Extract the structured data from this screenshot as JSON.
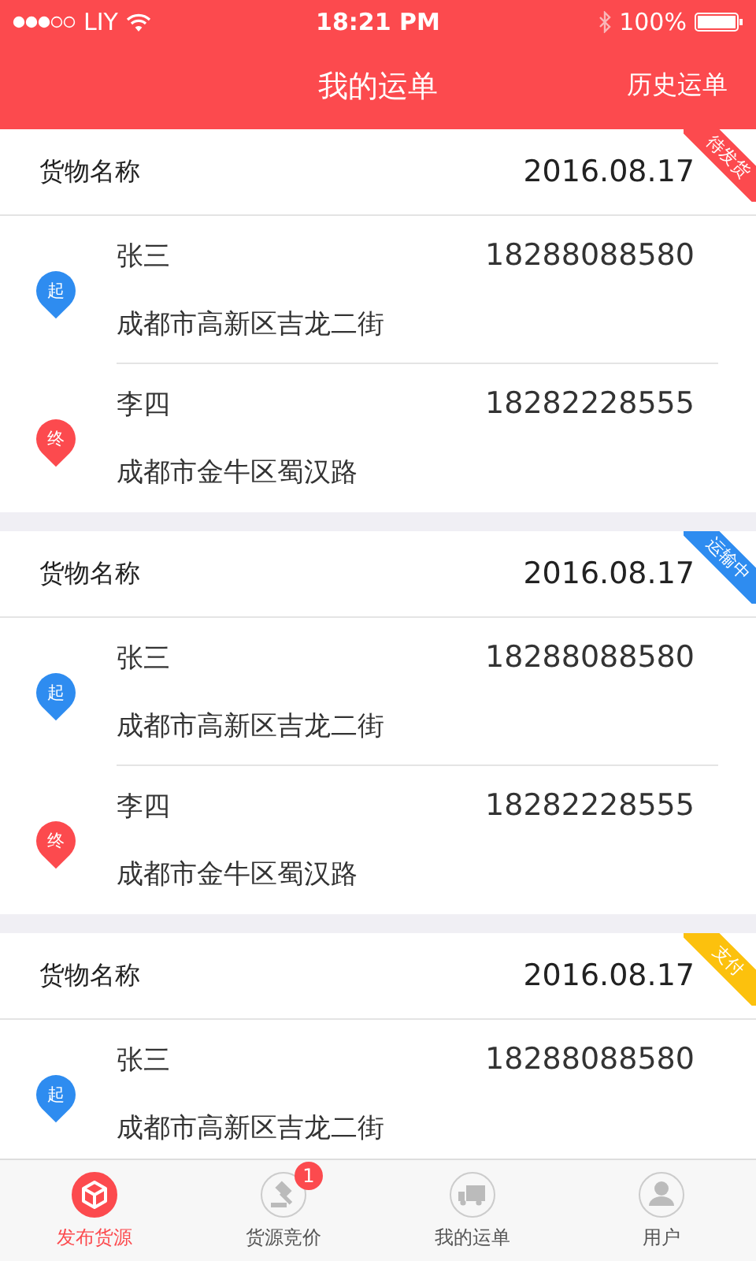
{
  "status_bar": {
    "carrier": "LIY",
    "time": "18:21 PM",
    "battery": "100%"
  },
  "nav": {
    "title": "我的运单",
    "action": "历史运单"
  },
  "orders": [
    {
      "cargo": "货物名称",
      "date": "2016.08.17",
      "status": "待发货",
      "color": "#fc4a4e",
      "stops": [
        {
          "kind": "start",
          "pin": "起",
          "name": "张三",
          "phone": "18288088580",
          "address": "成都市高新区吉龙二街"
        },
        {
          "kind": "end",
          "pin": "终",
          "name": "李四",
          "phone": "18282228555",
          "address": "成都市金牛区蜀汉路"
        }
      ]
    },
    {
      "cargo": "货物名称",
      "date": "2016.08.17",
      "status": "运输中",
      "color": "#2e8cf0",
      "stops": [
        {
          "kind": "start",
          "pin": "起",
          "name": "张三",
          "phone": "18288088580",
          "address": "成都市高新区吉龙二街"
        },
        {
          "kind": "end",
          "pin": "终",
          "name": "李四",
          "phone": "18282228555",
          "address": "成都市金牛区蜀汉路"
        }
      ]
    },
    {
      "cargo": "货物名称",
      "date": "2016.08.17",
      "status": "支付",
      "color": "#fcc10d",
      "stops": [
        {
          "kind": "start",
          "pin": "起",
          "name": "张三",
          "phone": "18288088580",
          "address": "成都市高新区吉龙二街"
        }
      ]
    }
  ],
  "tab_bar": [
    {
      "kind": "box",
      "label": "发布货源",
      "selected": true
    },
    {
      "kind": "gavel",
      "label": "货源竞价",
      "selected": false,
      "badge": "1"
    },
    {
      "kind": "truck",
      "label": "我的运单",
      "selected": false
    },
    {
      "kind": "user",
      "label": "用户",
      "selected": false
    }
  ]
}
